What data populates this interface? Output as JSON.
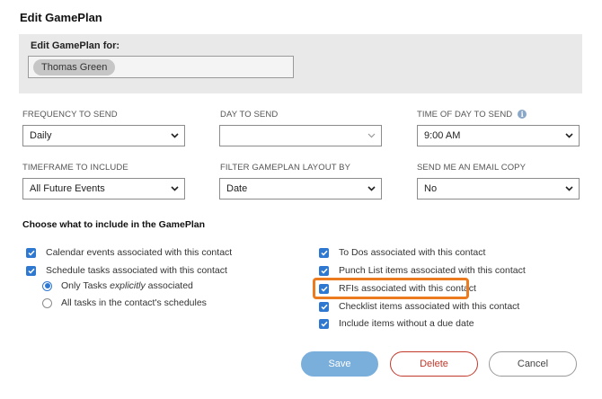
{
  "dialog": {
    "title": "Edit GamePlan"
  },
  "for_section": {
    "label": "Edit GamePlan for:",
    "contact": "Thomas Green"
  },
  "fields": {
    "frequency": {
      "label": "FREQUENCY TO SEND",
      "value": "Daily"
    },
    "day": {
      "label": "DAY TO SEND",
      "value": ""
    },
    "time": {
      "label": "TIME OF DAY TO SEND",
      "value": "9:00 AM"
    },
    "timeframe": {
      "label": "TIMEFRAME TO INCLUDE",
      "value": "All Future Events"
    },
    "layout": {
      "label": "FILTER GAMEPLAN LAYOUT BY",
      "value": "Date"
    },
    "email_copy": {
      "label": "SEND ME AN EMAIL COPY",
      "value": "No"
    }
  },
  "include": {
    "title": "Choose what to include in the GamePlan",
    "calendar_events": "Calendar events associated with this contact",
    "schedule_tasks": "Schedule tasks associated with this contact",
    "only_tasks_prefix": "Only Tasks ",
    "only_tasks_em": "explicitly",
    "only_tasks_suffix": " associated",
    "all_tasks": "All tasks in the contact's schedules",
    "todos": "To Dos associated with this contact",
    "punch_list": "Punch List items associated with this contact",
    "rfis": "RFIs associated with this contact",
    "checklist": "Checklist items associated with this contact",
    "no_due_date": "Include items without a due date"
  },
  "buttons": {
    "save": "Save",
    "delete": "Delete",
    "cancel": "Cancel"
  },
  "colors": {
    "accent": "#2f78d1",
    "highlight": "#ec7a1f",
    "save_bg": "#7aaedb",
    "delete": "#c0392b"
  }
}
